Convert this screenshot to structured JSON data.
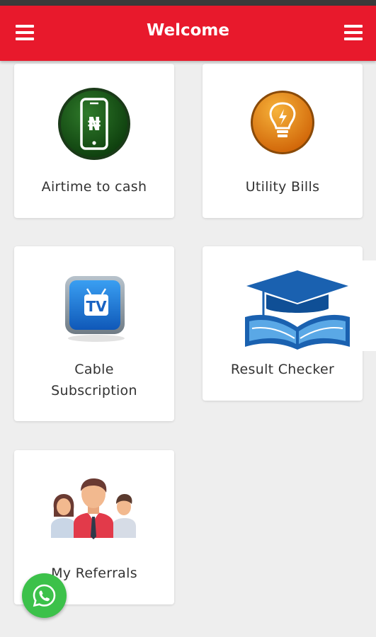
{
  "header": {
    "title": "Welcome",
    "left_menu_icon": "hamburger-menu-icon",
    "right_menu_icon": "hamburger-menu-icon",
    "color": "#e8192c"
  },
  "cards": [
    {
      "label": "Airtime to cash",
      "icon": "naira-phone-icon"
    },
    {
      "label": "Utility Bills",
      "icon": "lightbulb-icon"
    },
    {
      "label_line1": "Cable",
      "label_line2": "Subscription",
      "icon": "tv-icon"
    },
    {
      "label": "Result Checker",
      "icon": "graduation-cap-book-icon"
    },
    {
      "label": "My Referrals",
      "icon": "people-group-icon"
    }
  ],
  "fab": {
    "icon": "whatsapp-icon",
    "color": "#3cc14a"
  }
}
